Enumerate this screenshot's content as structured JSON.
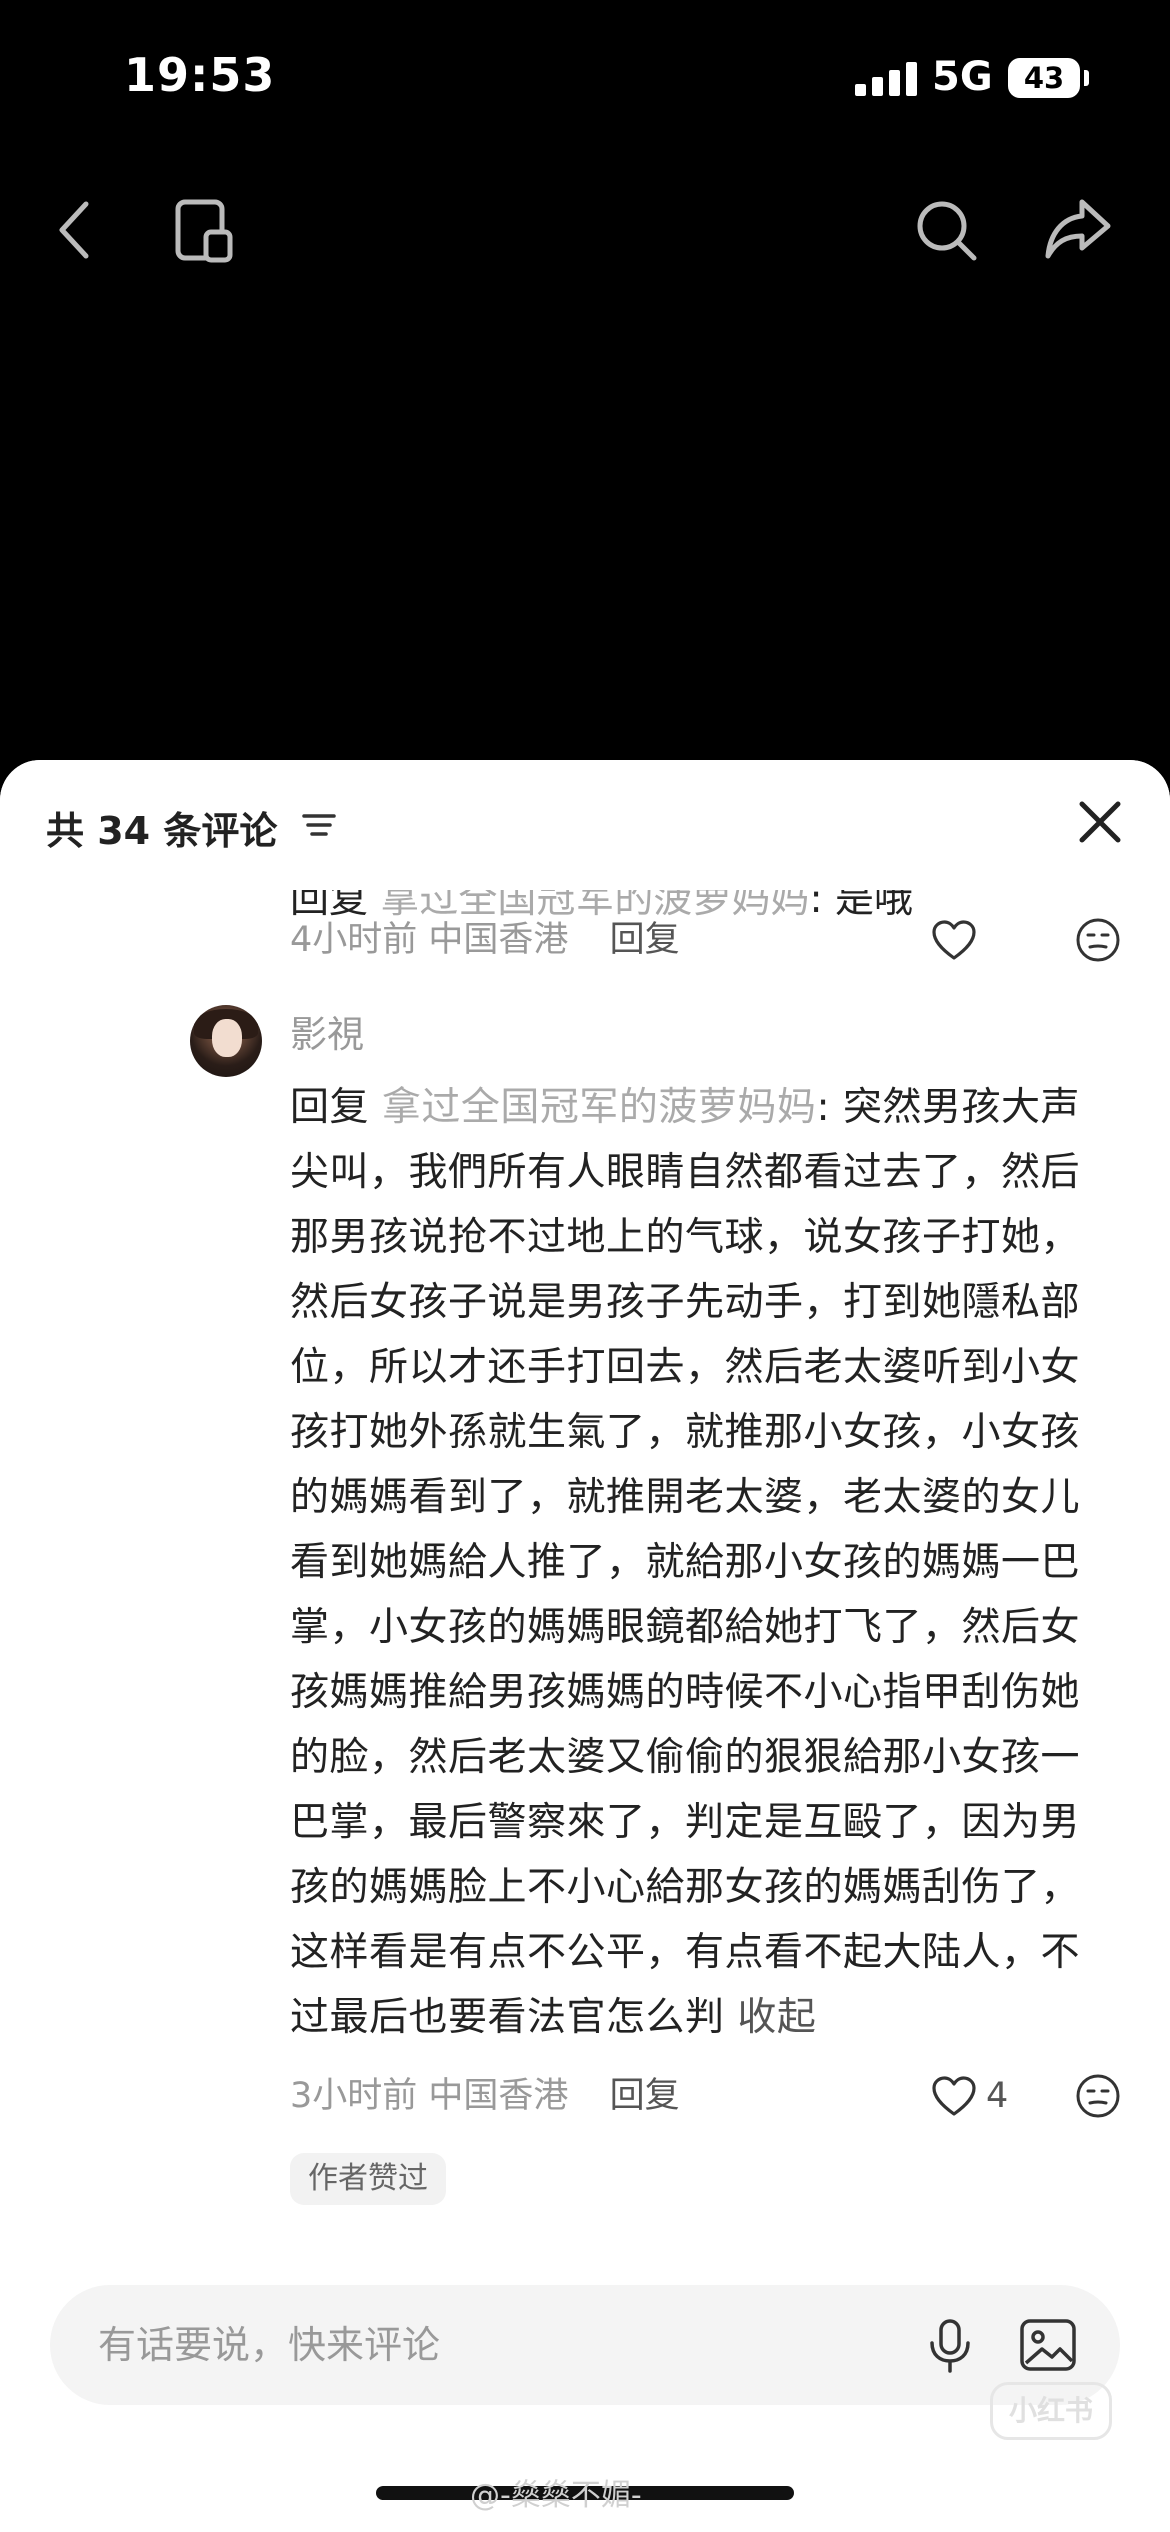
{
  "status_bar": {
    "time": "19:53",
    "network": "5G",
    "battery": "43"
  },
  "nav": {
    "back_icon": "chevron-left-icon",
    "page_icon": "page-pip-icon",
    "search_icon": "search-icon",
    "share_icon": "share-arrow-icon"
  },
  "comments_panel": {
    "title": "共 34 条评论",
    "filter_icon": "filter-lines-icon",
    "close_icon": "close-x-icon"
  },
  "previous_comment": {
    "cut_prefix": "回复",
    "cut_target": "拿过全国冠军的菠萝妈妈",
    "cut_text": ": 是哦",
    "time": "4小时前",
    "location": "中国香港",
    "reply_label": "回复"
  },
  "comment": {
    "author": "影視",
    "reply_prefix": "回复",
    "reply_target": "拿过全国冠军的菠萝妈妈",
    "text": ": 突然男孩大声尖叫，我們所有人眼睛自然都看过去了，然后那男孩说抢不过地上的气球，说女孩子打她，然后女孩子说是男孩子先动手，打到她隱私部位，所以才还手打回去，然后老太婆听到小女孩打她外孫就生氣了，就推那小女孩，小女孩的媽媽看到了，就推開老太婆，老太婆的女儿看到她媽給人推了，就給那小女孩的媽媽一巴掌，小女孩的媽媽眼鏡都給她打飞了，然后女孩媽媽推給男孩媽媽的時候不小心指甲刮伤她的脸，然后老太婆又偷偷的狠狠給那小女孩一巴掌，最后警察來了，判定是互毆了，因为男孩的媽媽脸上不小心給那女孩的媽媽刮伤了，这样看是有点不公平，有点看不起大陆人，不过最后也要看法官怎么判",
    "collapse_label": "收起",
    "time": "3小时前",
    "location": "中国香港",
    "reply_label": "回复",
    "like_count": "4",
    "badge": "作者赞过"
  },
  "input": {
    "placeholder": "有话要说，快来评论",
    "mic_icon": "microphone-icon",
    "image_icon": "image-icon"
  },
  "watermark": {
    "logo_text": "小红书",
    "credit": "@-燊燊不媚-"
  }
}
